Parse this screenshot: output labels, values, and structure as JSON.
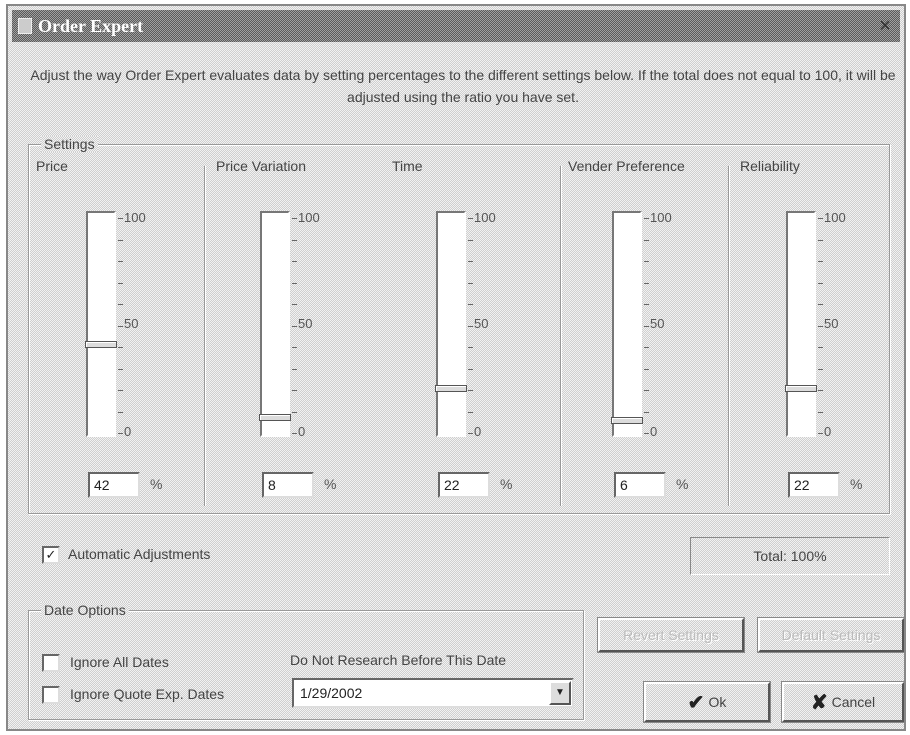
{
  "window": {
    "title": "Order Expert",
    "close_glyph": "×"
  },
  "description": "Adjust the way Order Expert evaluates data by setting percentages to the different settings below. If the total does not equal to 100, it will be adjusted using the ratio you have set.",
  "settings": {
    "group_label": "Settings",
    "tick_labels": {
      "top": "100",
      "mid": "50",
      "bottom": "0"
    },
    "percent_symbol": "%",
    "columns": [
      {
        "label": "Price",
        "value": "42"
      },
      {
        "label": "Price Variation",
        "value": "8"
      },
      {
        "label": "Time",
        "value": "22"
      },
      {
        "label": "Vender Preference",
        "value": "6"
      },
      {
        "label": "Reliability",
        "value": "22"
      }
    ]
  },
  "automatic_adjustments": {
    "label": "Automatic Adjustments",
    "checked": true,
    "check_glyph": "✓"
  },
  "total": {
    "text": "Total: 100%"
  },
  "date_options": {
    "group_label": "Date Options",
    "ignore_all_dates": {
      "label": "Ignore All Dates",
      "checked": false
    },
    "ignore_quote_exp_dates": {
      "label": "Ignore Quote Exp. Dates",
      "checked": false
    },
    "research_label": "Do Not Research Before This Date",
    "date_value": "1/29/2002",
    "dropdown_glyph": "▼"
  },
  "buttons": {
    "revert": "Revert Settings",
    "default": "Default Settings",
    "ok": "Ok",
    "ok_glyph": "✔",
    "cancel": "Cancel",
    "cancel_glyph": "✘"
  },
  "colors": {
    "title_bar": "#6e6e6e",
    "dialog_bg": "#dcdcdc"
  }
}
